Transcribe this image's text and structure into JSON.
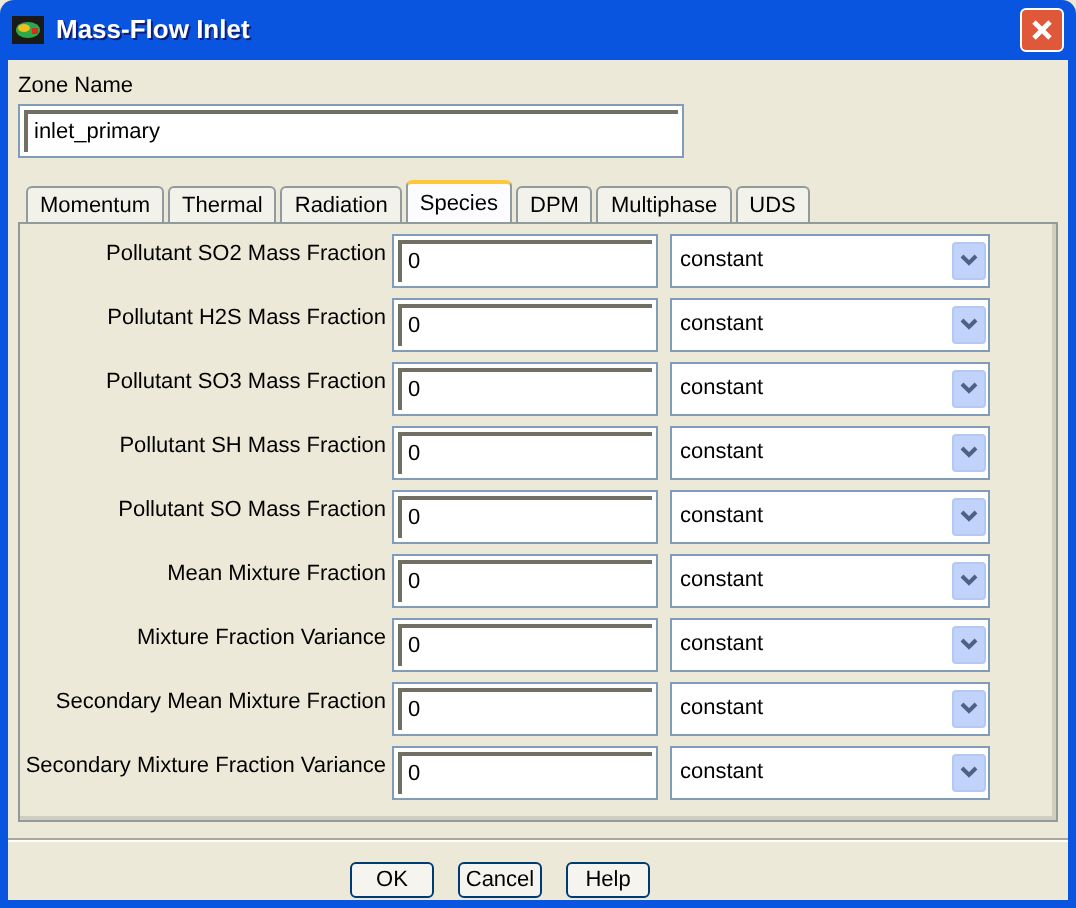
{
  "window": {
    "title": "Mass-Flow Inlet"
  },
  "zone": {
    "label": "Zone Name",
    "value": "inlet_primary"
  },
  "tabs": [
    {
      "label": "Momentum",
      "selected": false
    },
    {
      "label": "Thermal",
      "selected": false
    },
    {
      "label": "Radiation",
      "selected": false
    },
    {
      "label": "Species",
      "selected": true
    },
    {
      "label": "DPM",
      "selected": false
    },
    {
      "label": "Multiphase",
      "selected": false
    },
    {
      "label": "UDS",
      "selected": false
    }
  ],
  "rows": [
    {
      "label": "Pollutant SO2 Mass Fraction",
      "value": "0",
      "method": "constant"
    },
    {
      "label": "Pollutant H2S Mass Fraction",
      "value": "0",
      "method": "constant"
    },
    {
      "label": "Pollutant SO3 Mass Fraction",
      "value": "0",
      "method": "constant"
    },
    {
      "label": "Pollutant SH Mass Fraction",
      "value": "0",
      "method": "constant"
    },
    {
      "label": "Pollutant SO Mass Fraction",
      "value": "0",
      "method": "constant"
    },
    {
      "label": "Mean Mixture Fraction",
      "value": "0",
      "method": "constant"
    },
    {
      "label": "Mixture Fraction Variance",
      "value": "0",
      "method": "constant"
    },
    {
      "label": "Secondary Mean Mixture Fraction",
      "value": "0",
      "method": "constant"
    },
    {
      "label": "Secondary Mixture Fraction Variance",
      "value": "0",
      "method": "constant"
    }
  ],
  "buttons": [
    "OK",
    "Cancel",
    "Help"
  ]
}
